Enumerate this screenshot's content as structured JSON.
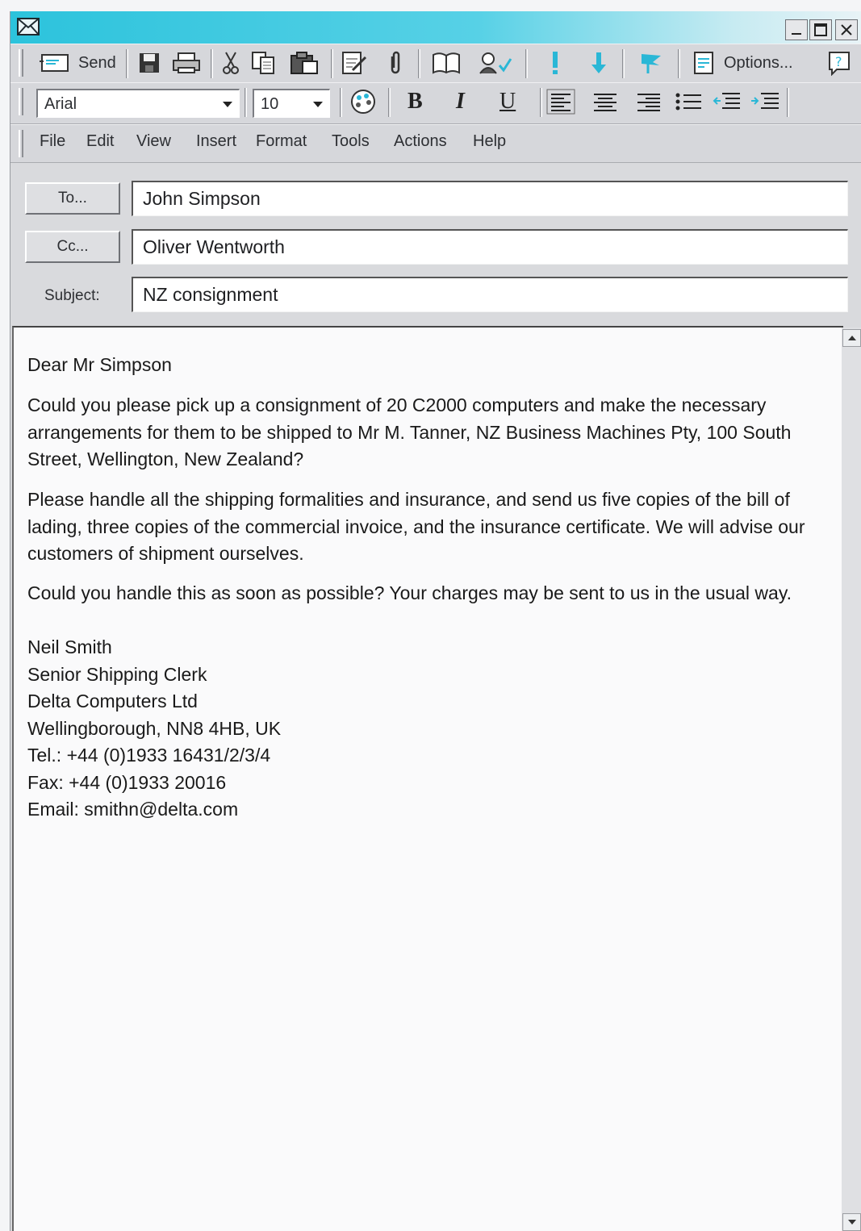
{
  "window": {
    "icons": {
      "app": "envelope-icon",
      "minimize": "minimize-icon",
      "maximize": "maximize-icon",
      "close": "close-icon"
    }
  },
  "toolbar_standard": {
    "send_label": "Send",
    "options_label": "Options...",
    "icons": [
      "send-icon",
      "save-icon",
      "print-icon",
      "cut-icon",
      "copy-icon",
      "paste-icon",
      "insert-file-icon",
      "attach-icon",
      "address-book-icon",
      "check-names-icon",
      "importance-high-icon",
      "importance-low-icon",
      "flag-icon",
      "options-icon",
      "help-icon"
    ]
  },
  "toolbar_format": {
    "font_name": "Arial",
    "font_size": "10",
    "bold": "B",
    "italic": "I",
    "underline": "U",
    "icons": [
      "font-color-icon",
      "align-left-icon",
      "align-center-icon",
      "align-right-icon",
      "bullets-icon",
      "decrease-indent-icon",
      "increase-indent-icon"
    ]
  },
  "menu": [
    "File",
    "Edit",
    "View",
    "Insert",
    "Format",
    "Tools",
    "Actions",
    "Help"
  ],
  "header": {
    "to_button": "To...",
    "to_value": "John Simpson",
    "cc_button": "Cc...",
    "cc_value": "Oliver Wentworth",
    "subject_label": "Subject:",
    "subject_value": "NZ consignment"
  },
  "message": {
    "greeting": "Dear Mr Simpson",
    "para1": "Could you please pick up a consignment of 20 C2000 computers and make the necessary arrangements for them to be shipped to Mr M. Tanner, NZ Business Machines Pty, 100 South Street, Wellington, New Zealand?",
    "para2": "Please handle all the shipping formalities and insurance, and send us five copies of the bill of lading, three copies of the commercial invoice, and the insurance certificate. We will advise our customers of shipment ourselves.",
    "para3": "Could you handle this as soon as possible? Your charges may be sent to us in the usual way.",
    "signature": [
      "Neil Smith",
      "Senior Shipping Clerk",
      "Delta Computers Ltd",
      "Wellingborough, NN8 4HB, UK",
      "Tel.: +44 (0)1933 16431/2/3/4",
      "Fax: +44 (0)1933 20016",
      "Email: smithn@delta.com"
    ]
  },
  "colors": {
    "titlebar": "#2cc3dc",
    "importance_icon": "#2ab7d6",
    "toolbar": "#d6d7db"
  }
}
